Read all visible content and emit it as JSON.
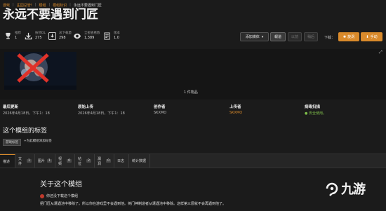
{
  "breadcrumb": [
    {
      "label": "游戏"
    },
    {
      "label": "庄园总管!"
    },
    {
      "label": "模组"
    },
    {
      "label": "模组标识"
    },
    {
      "label": "永远不要遇到门匠"
    }
  ],
  "title": "永远不要遇到门匠",
  "stats": [
    {
      "icon": "trophy-icon",
      "label": "推荐",
      "value": "1"
    },
    {
      "icon": "download-icon",
      "label": "按项DL",
      "value": "275"
    },
    {
      "icon": "download-icon",
      "label": "总下载量",
      "value": "298"
    },
    {
      "icon": "eye-icon",
      "label": "全部查看数",
      "value": "1,389"
    },
    {
      "icon": "version-icon",
      "label": "版本",
      "value": "1.0"
    }
  ],
  "actions": {
    "add_collection": "添加媒体",
    "report": "報道",
    "prev": "以前",
    "next": "稍后",
    "download_label": "下载：",
    "vortex": "旋涡",
    "manual": "手动"
  },
  "gallery": {
    "count_label": "1 件物品"
  },
  "info": {
    "last_updated": {
      "label": "最后更新",
      "value": "2026年4月18日，下午1：18"
    },
    "original_upload": {
      "label": "原始上传",
      "value": "2026年4月18日，下午1：18"
    },
    "creator": {
      "label": "创作者",
      "value": "SKXMO"
    },
    "uploader": {
      "label": "上传者",
      "value": "SKXMO"
    },
    "virus_scan": {
      "label": "病毒扫描",
      "value": "安全使用。"
    }
  },
  "tags": {
    "heading": "这个模组的标签",
    "chip": "游戏标签",
    "add": "为此模组添加标签"
  },
  "tabs": [
    {
      "label": "描述",
      "badge": ""
    },
    {
      "label": "文件",
      "badge": "1"
    },
    {
      "label": "图片",
      "badge": "1"
    },
    {
      "label": "视频",
      "badge": "0"
    },
    {
      "label": "帖位",
      "badge": "2"
    },
    {
      "label": "漏洞",
      "badge": "0"
    },
    {
      "label": "日志",
      "badge": ""
    },
    {
      "label": "统计数据",
      "badge": ""
    }
  ],
  "about": {
    "heading": "关于这个模组",
    "warning": "你还没下载这个模组",
    "body": "把门匠从遭遇池中移除了。所以你在游戏里不会遇到他。将门神制造者从遭遇池中移除。这样第三层就不会再遇到他了。"
  },
  "watermark": {
    "text": "九游"
  },
  "colors": {
    "accent": "#d98a2b",
    "background": "#1b1b1b",
    "ok": "#7fbf4a"
  }
}
